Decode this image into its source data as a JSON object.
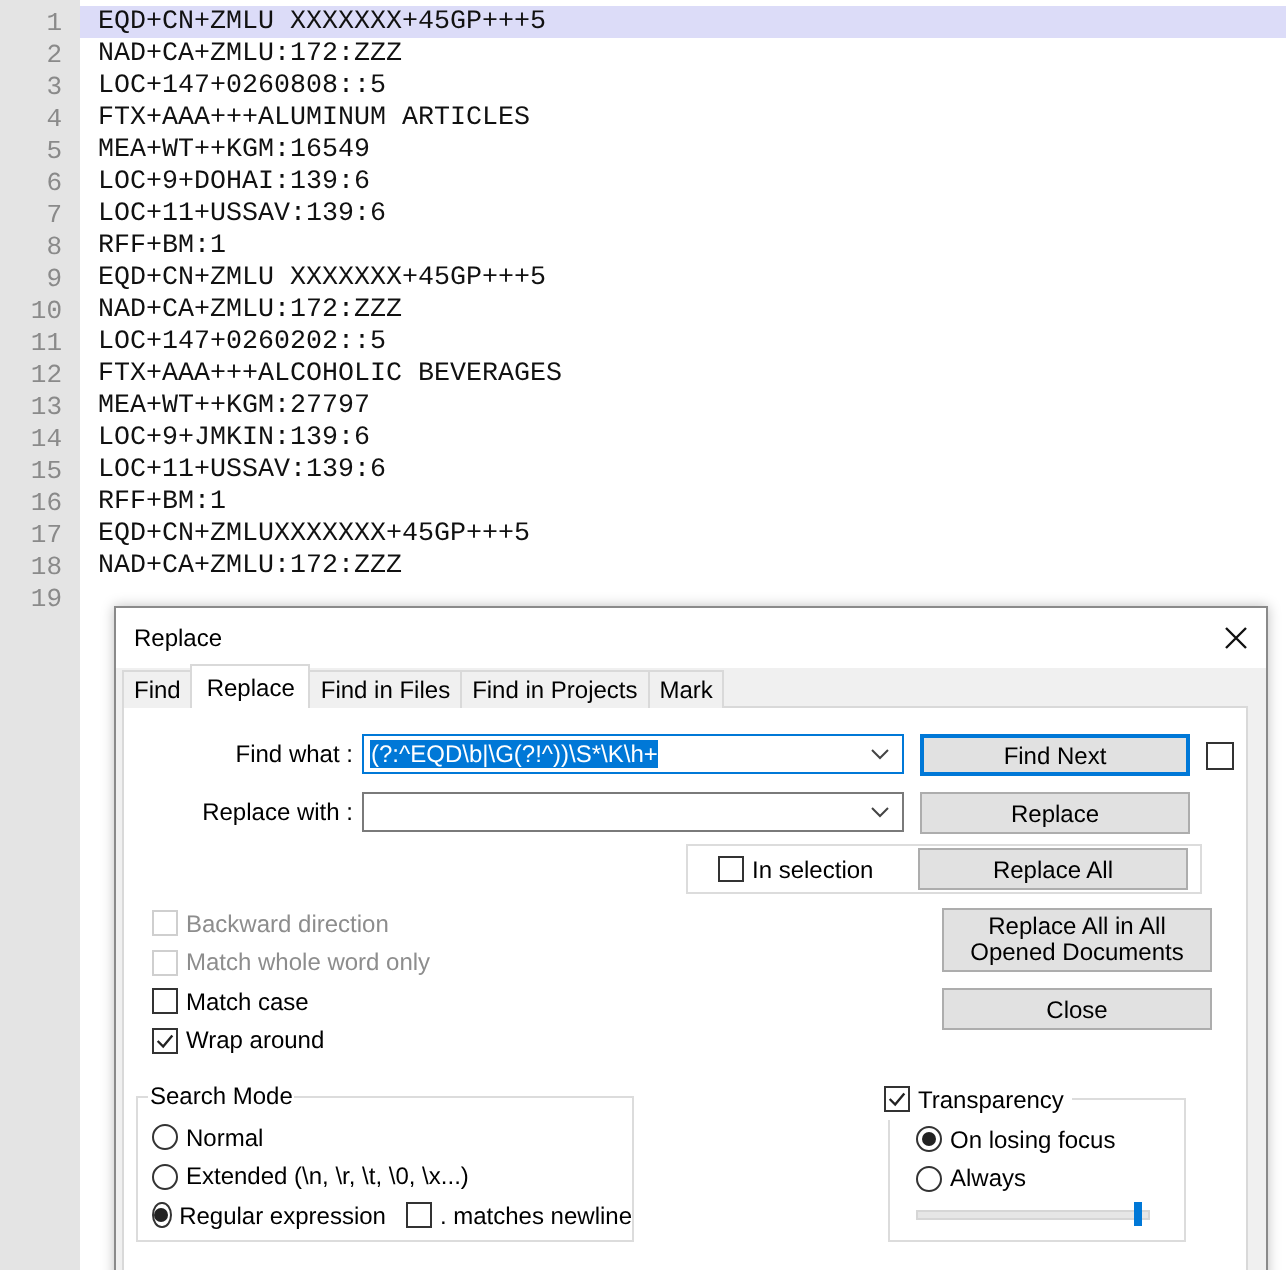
{
  "editor": {
    "lines": [
      {
        "number": "1",
        "text": "EQD+CN+ZMLU XXXXXXX+45GP+++5",
        "current": true
      },
      {
        "number": "2",
        "text": "NAD+CA+ZMLU:172:ZZZ",
        "current": false
      },
      {
        "number": "3",
        "text": "LOC+147+0260808::5",
        "current": false
      },
      {
        "number": "4",
        "text": "FTX+AAA+++ALUMINUM ARTICLES",
        "current": false
      },
      {
        "number": "5",
        "text": "MEA+WT++KGM:16549",
        "current": false
      },
      {
        "number": "6",
        "text": "LOC+9+DOHAI:139:6",
        "current": false
      },
      {
        "number": "7",
        "text": "LOC+11+USSAV:139:6",
        "current": false
      },
      {
        "number": "8",
        "text": "RFF+BM:1",
        "current": false
      },
      {
        "number": "9",
        "text": "EQD+CN+ZMLU XXXXXXX+45GP+++5",
        "current": false
      },
      {
        "number": "10",
        "text": "NAD+CA+ZMLU:172:ZZZ",
        "current": false
      },
      {
        "number": "11",
        "text": "LOC+147+0260202::5",
        "current": false
      },
      {
        "number": "12",
        "text": "FTX+AAA+++ALCOHOLIC BEVERAGES",
        "current": false
      },
      {
        "number": "13",
        "text": "MEA+WT++KGM:27797",
        "current": false
      },
      {
        "number": "14",
        "text": "LOC+9+JMKIN:139:6",
        "current": false
      },
      {
        "number": "15",
        "text": "LOC+11+USSAV:139:6",
        "current": false
      },
      {
        "number": "16",
        "text": "RFF+BM:1",
        "current": false
      },
      {
        "number": "17",
        "text": "EQD+CN+ZMLUXXXXXXX+45GP+++5",
        "current": false
      },
      {
        "number": "18",
        "text": "NAD+CA+ZMLU:172:ZZZ",
        "current": false
      },
      {
        "number": "19",
        "current": false
      }
    ]
  },
  "dialog": {
    "title": "Replace",
    "tabs": [
      {
        "label": "Find",
        "selected": false
      },
      {
        "label": "Replace",
        "selected": true
      },
      {
        "label": "Find in Files",
        "selected": false
      },
      {
        "label": "Find in Projects",
        "selected": false
      },
      {
        "label": "Mark",
        "selected": false
      }
    ],
    "find_what": {
      "label": "Find what :",
      "value": "(?:^EQD\\b|\\G(?!^))\\S*\\K\\h+"
    },
    "replace_with": {
      "label": "Replace with :"
    },
    "find_next": {
      "label": "Find Next",
      "default": true
    },
    "extra_checkbox": {
      "checked": false
    },
    "replace_button": "Replace",
    "in_selection": {
      "label": "In selection",
      "checked": false
    },
    "replace_all": "Replace All",
    "replace_all_opened": "Replace All in All Opened Documents",
    "close_button": "Close",
    "options": [
      {
        "label": "Backward direction",
        "checked": false,
        "disabled": true
      },
      {
        "label": "Match whole word only",
        "checked": false,
        "disabled": true
      },
      {
        "label": "Match case",
        "checked": false,
        "disabled": false
      },
      {
        "label": "Wrap around",
        "checked": true,
        "disabled": false
      }
    ],
    "search_mode": {
      "title": "Search Mode",
      "options": [
        {
          "label": "Normal",
          "selected": false
        },
        {
          "label": "Extended (\\n, \\r, \\t, \\0, \\x...)",
          "selected": false
        },
        {
          "label": "Regular expression",
          "selected": true
        }
      ],
      "dot_newline": {
        "label": ". matches newline",
        "checked": false
      }
    },
    "transparency": {
      "label": "Transparency",
      "checked": true,
      "options": [
        {
          "label": "On losing focus",
          "selected": true
        },
        {
          "label": "Always",
          "selected": false
        }
      ],
      "level": 0.96
    }
  }
}
